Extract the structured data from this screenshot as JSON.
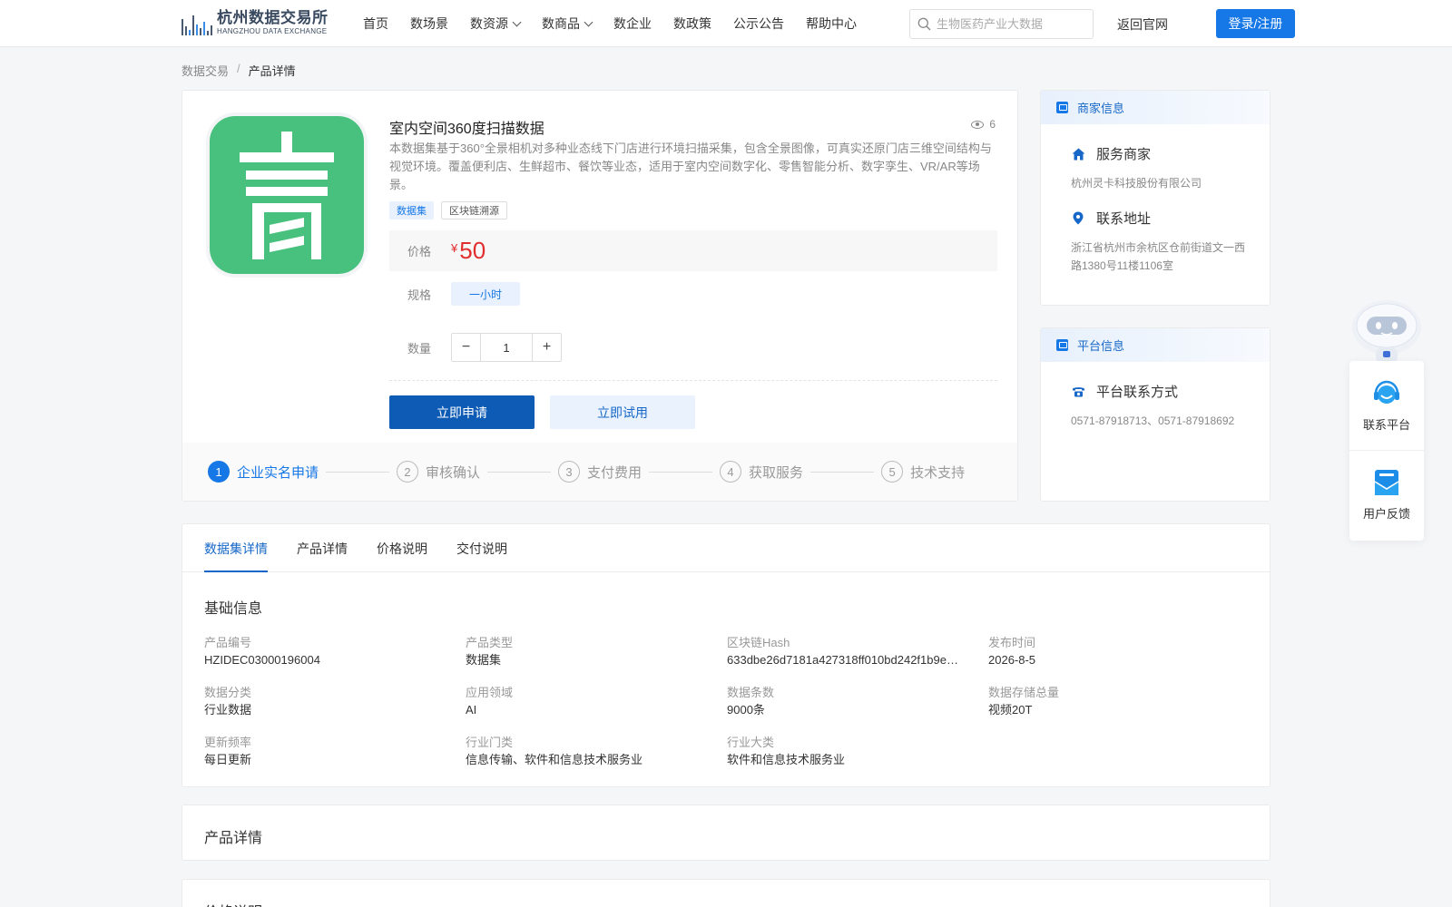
{
  "header": {
    "logo_cn": "杭州数据交易所",
    "logo_en": "HANGZHOU DATA EXCHANGE",
    "nav": [
      {
        "label": "首页",
        "dropdown": false
      },
      {
        "label": "数场景",
        "dropdown": false
      },
      {
        "label": "数资源",
        "dropdown": true
      },
      {
        "label": "数商品",
        "dropdown": true
      },
      {
        "label": "数企业",
        "dropdown": false
      },
      {
        "label": "数政策",
        "dropdown": false
      },
      {
        "label": "公示公告",
        "dropdown": false
      },
      {
        "label": "帮助中心",
        "dropdown": false
      }
    ],
    "search_placeholder": "生物医药产业大数据",
    "back_link": "返回官网",
    "login_label": "登录/注册"
  },
  "breadcrumb": {
    "parent": "数据交易",
    "separator": "/",
    "current": "产品详情"
  },
  "product": {
    "title": "室内空间360度扫描数据",
    "views": "6",
    "description": "本数据集基于360°全景相机对多种业态线下门店进行环境扫描采集，包含全景图像，可真实还原门店三维空间结构与视觉环境。覆盖便利店、生鲜超市、餐饮等业态，适用于室内空间数字化、零售智能分析、数字孪生、VR/AR等场景。",
    "tags": [
      "数据集",
      "区块链溯源"
    ],
    "price_label": "价格",
    "currency": "¥",
    "price": "50",
    "spec_label": "规格",
    "spec_option": "一小时",
    "qty_label": "数量",
    "qty_minus": "−",
    "qty_value": "1",
    "qty_plus": "+",
    "apply_label": "立即申请",
    "trial_label": "立即试用",
    "steps": [
      {
        "num": "1",
        "label": "企业实名申请",
        "active": true
      },
      {
        "num": "2",
        "label": "审核确认",
        "active": false
      },
      {
        "num": "3",
        "label": "支付费用",
        "active": false
      },
      {
        "num": "4",
        "label": "获取服务",
        "active": false
      },
      {
        "num": "5",
        "label": "技术支持",
        "active": false
      }
    ]
  },
  "merchant": {
    "header": "商家信息",
    "service_title": "服务商家",
    "service_value": "杭州灵卡科技股份有限公司",
    "address_title": "联系地址",
    "address_value": "浙江省杭州市余杭区仓前街道文一西路1380号11楼1106室"
  },
  "platform": {
    "header": "平台信息",
    "contact_title": "平台联系方式",
    "contact_value": "0571-87918713、0571-87918692"
  },
  "float": {
    "contact_label": "联系平台",
    "feedback_label": "用户反馈"
  },
  "details": {
    "tabs": [
      "数据集详情",
      "产品详情",
      "价格说明",
      "交付说明"
    ],
    "active_tab": 0,
    "section_title": "基础信息",
    "fields": [
      {
        "key": "产品编号",
        "value": "HZIDEC03000196004"
      },
      {
        "key": "产品类型",
        "value": "数据集"
      },
      {
        "key": "区块链Hash",
        "value": "633dbe26d7181a427318ff010bd242f1b9e…"
      },
      {
        "key": "发布时间",
        "value": "2026-8-5"
      },
      {
        "key": "数据分类",
        "value": "行业数据"
      },
      {
        "key": "应用领域",
        "value": "AI"
      },
      {
        "key": "数据条数",
        "value": "9000条"
      },
      {
        "key": "数据存储总量",
        "value": "视频20T"
      },
      {
        "key": "更新频率",
        "value": "每日更新"
      },
      {
        "key": "行业门类",
        "value": "信息传输、软件和信息技术服务业"
      },
      {
        "key": "行业大类",
        "value": "软件和信息技术服务业"
      }
    ],
    "section2_title": "产品详情",
    "section3_title": "价格说明"
  },
  "colors": {
    "primary": "#1677e6",
    "primary_dark": "#0e5bb6",
    "price": "#e22d2d",
    "product_icon_bg": "#47c17d"
  }
}
